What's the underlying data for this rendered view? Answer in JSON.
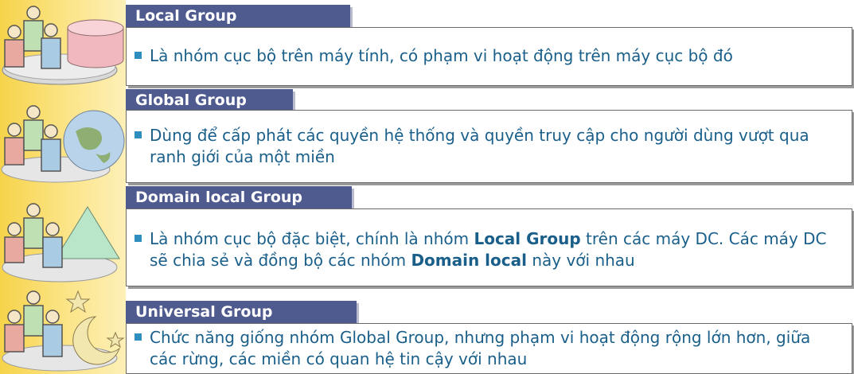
{
  "colors": {
    "accent": "#4f5a8e",
    "text": "#1a5f8a",
    "bullet": "#2e8fbf",
    "sidebar": "#f6d34a"
  },
  "sections": [
    {
      "title": "Local Group",
      "icon": "people-with-database-icon",
      "segments": [
        {
          "text": "Là nhóm cục bộ trên máy tính, có phạm vi hoạt động trên máy cục bộ đó",
          "bold": false
        }
      ]
    },
    {
      "title": "Global Group",
      "icon": "people-with-globe-icon",
      "segments": [
        {
          "text": "Dùng để cấp phát các quyền hệ thống và quyền truy cập cho người dùng vượt qua ranh giới của một miền",
          "bold": false
        }
      ]
    },
    {
      "title": "Domain local Group",
      "icon": "people-with-triangle-icon",
      "segments": [
        {
          "text": "Là nhóm cục bộ đặc biệt, chính là nhóm ",
          "bold": false
        },
        {
          "text": "Local Group",
          "bold": true
        },
        {
          "text": " trên các máy DC. Các máy DC sẽ chia sẻ và đồng bộ các nhóm ",
          "bold": false
        },
        {
          "text": "Domain local",
          "bold": true
        },
        {
          "text": " này với nhau",
          "bold": false
        }
      ]
    },
    {
      "title": "Universal Group",
      "icon": "people-with-moon-stars-icon",
      "segments": [
        {
          "text": "Chức năng giống nhóm Global Group, nhưng phạm vi hoạt động rộng lớn hơn, giữa các rừng, các miền có quan hệ tin cậy với nhau",
          "bold": false
        }
      ]
    }
  ]
}
